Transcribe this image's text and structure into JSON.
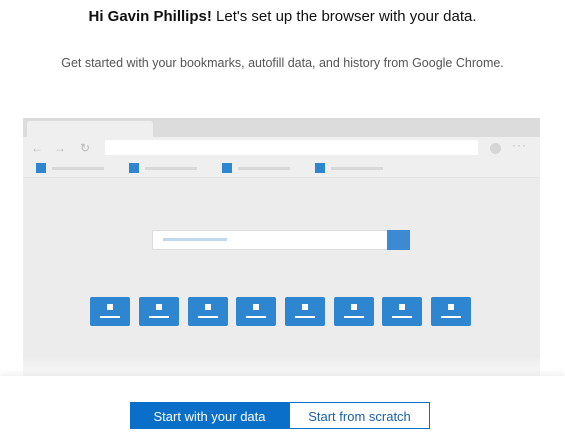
{
  "heading": {
    "greeting": "Hi Gavin Phillips!",
    "text": " Let's set up the browser with your data."
  },
  "subtitle": "Get started with your bookmarks, autofill data, and history from Google Chrome.",
  "illustration": {
    "nav_icons": [
      "back-arrow-icon",
      "forward-arrow-icon",
      "refresh-icon"
    ],
    "back_glyph": "←",
    "forward_glyph": "→",
    "refresh_glyph": "↻",
    "more_glyph": "···",
    "accent_color": "#2e85d0",
    "tile_count": 8
  },
  "buttons": {
    "primary_label": "Start with your data",
    "secondary_label": "Start from scratch"
  },
  "colors": {
    "primary": "#0a6fc9",
    "background": "#ffffff",
    "illustration_bg": "#ececec"
  }
}
